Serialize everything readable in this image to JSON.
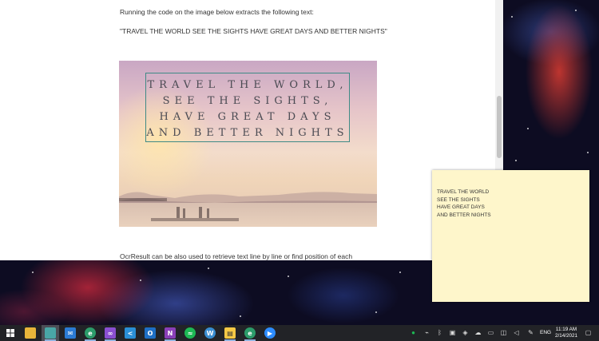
{
  "document": {
    "intro_text": "Running the code on the image below extracts the following text:",
    "extracted_text": "\"TRAVEL THE WORLD SEE THE SIGHTS HAVE GREAT DAYS AND BETTER NIGHTS\"",
    "image_quote_lines": [
      "TRAVEL THE WORLD,",
      "SEE THE SIGHTS,",
      "HAVE GREAT DAYS",
      "AND BETTER NIGHTS"
    ],
    "footer_text": "OcrResult can be also used to retrieve text line by line or find position of each"
  },
  "sticky_note": {
    "lines": [
      "TRAVEL THE WORLD",
      "SEE THE SIGHTS",
      "HAVE GREAT DAYS",
      "AND BETTER NIGHTS"
    ]
  },
  "taskbar": {
    "apps": [
      {
        "name": "file-explorer",
        "color": "#e8b53a"
      },
      {
        "name": "app-active",
        "color": "#49a6a6"
      },
      {
        "name": "mail",
        "color": "#2b7bd4"
      },
      {
        "name": "edge",
        "color": "#2c9c6a"
      },
      {
        "name": "visual-studio",
        "color": "#8a4fd1"
      },
      {
        "name": "vs-code",
        "color": "#2a8fd6"
      },
      {
        "name": "outlook",
        "color": "#1e6fc5"
      },
      {
        "name": "onenote",
        "color": "#8a3fb8"
      },
      {
        "name": "spotify",
        "color": "#1db954"
      },
      {
        "name": "wordpress",
        "color": "#3a8ed1"
      },
      {
        "name": "sticky-notes",
        "color": "#f6c945"
      },
      {
        "name": "edge-beta",
        "color": "#2c9c6a"
      },
      {
        "name": "zoom",
        "color": "#2d8cff"
      }
    ],
    "language": "ENG",
    "time": "11:19 AM",
    "date": "2/14/2021"
  }
}
